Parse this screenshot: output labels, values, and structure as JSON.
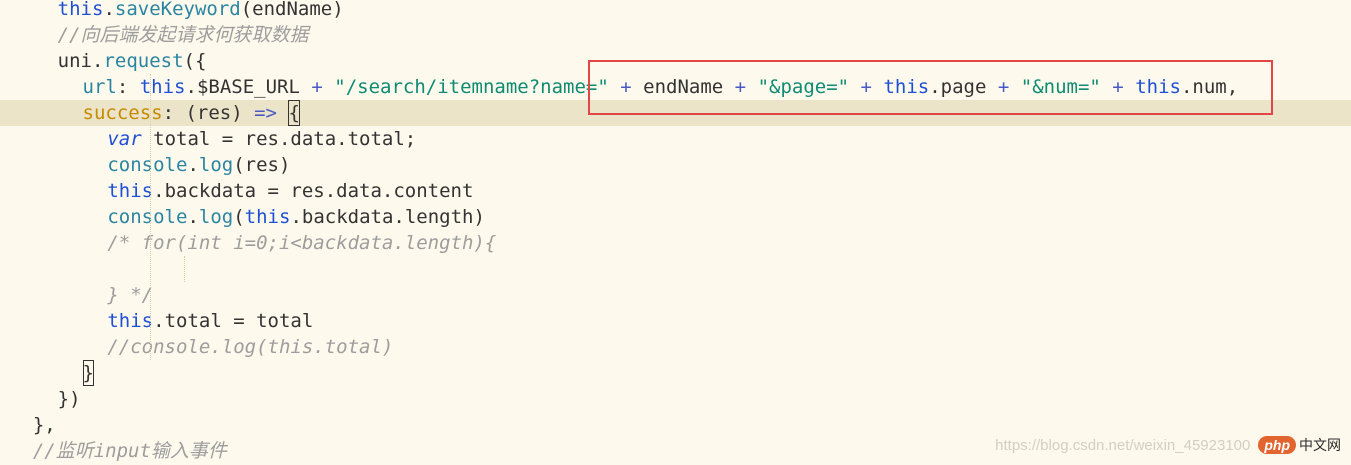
{
  "code_lines": [
    {
      "indent": 4,
      "tokens": [
        {
          "t": "this",
          "c": "kw"
        },
        {
          "t": ".",
          "c": "txt"
        },
        {
          "t": "saveKeyword",
          "c": "fn"
        },
        {
          "t": "(endName)",
          "c": "txt"
        }
      ]
    },
    {
      "indent": 4,
      "tokens": [
        {
          "t": "//向后端发起请求何获取数据",
          "c": "cmt"
        }
      ]
    },
    {
      "indent": 4,
      "tokens": [
        {
          "t": "uni",
          "c": "txt"
        },
        {
          "t": ".",
          "c": "txt"
        },
        {
          "t": "request",
          "c": "fn"
        },
        {
          "t": "({",
          "c": "txt"
        }
      ]
    },
    {
      "indent": 6,
      "tokens": [
        {
          "t": "url",
          "c": "fn"
        },
        {
          "t": ": ",
          "c": "txt"
        },
        {
          "t": "this",
          "c": "kw"
        },
        {
          "t": ".$BASE_URL ",
          "c": "txt"
        },
        {
          "t": "+",
          "c": "op"
        },
        {
          "t": " ",
          "c": "txt"
        },
        {
          "t": "\"/search/itemname?name=\"",
          "c": "str"
        },
        {
          "t": " ",
          "c": "txt"
        },
        {
          "t": "+",
          "c": "op"
        },
        {
          "t": " endName ",
          "c": "txt"
        },
        {
          "t": "+",
          "c": "op"
        },
        {
          "t": " ",
          "c": "txt"
        },
        {
          "t": "\"&page=\"",
          "c": "str"
        },
        {
          "t": " ",
          "c": "txt"
        },
        {
          "t": "+",
          "c": "op"
        },
        {
          "t": " ",
          "c": "txt"
        },
        {
          "t": "this",
          "c": "kw"
        },
        {
          "t": ".page ",
          "c": "txt"
        },
        {
          "t": "+",
          "c": "op"
        },
        {
          "t": " ",
          "c": "txt"
        },
        {
          "t": "\"&num=\"",
          "c": "str"
        },
        {
          "t": " ",
          "c": "txt"
        },
        {
          "t": "+",
          "c": "op"
        },
        {
          "t": " ",
          "c": "txt"
        },
        {
          "t": "this",
          "c": "kw"
        },
        {
          "t": ".num,",
          "c": "txt"
        }
      ]
    },
    {
      "indent": 6,
      "current": true,
      "tokens": [
        {
          "t": "success",
          "c": "key"
        },
        {
          "t": ": (res) ",
          "c": "txt"
        },
        {
          "t": "=>",
          "c": "op"
        },
        {
          "t": " ",
          "c": "txt"
        },
        {
          "t": "{",
          "c": "txt",
          "cursor": true
        }
      ]
    },
    {
      "indent": 8,
      "tokens": [
        {
          "t": "var",
          "c": "var"
        },
        {
          "t": " total = res.data.total;",
          "c": "txt"
        }
      ]
    },
    {
      "indent": 8,
      "tokens": [
        {
          "t": "console",
          "c": "fn"
        },
        {
          "t": ".",
          "c": "txt"
        },
        {
          "t": "log",
          "c": "fn"
        },
        {
          "t": "(res)",
          "c": "txt"
        }
      ]
    },
    {
      "indent": 8,
      "tokens": [
        {
          "t": "this",
          "c": "kw"
        },
        {
          "t": ".backdata = res.data.content",
          "c": "txt"
        }
      ]
    },
    {
      "indent": 8,
      "tokens": [
        {
          "t": "console",
          "c": "fn"
        },
        {
          "t": ".",
          "c": "txt"
        },
        {
          "t": "log",
          "c": "fn"
        },
        {
          "t": "(",
          "c": "txt"
        },
        {
          "t": "this",
          "c": "kw"
        },
        {
          "t": ".backdata.length)",
          "c": "txt"
        }
      ]
    },
    {
      "indent": 8,
      "tokens": [
        {
          "t": "/* for(int i=0;i<backdata.length){",
          "c": "cmt"
        }
      ]
    },
    {
      "indent": 8,
      "tokens": []
    },
    {
      "indent": 8,
      "tokens": [
        {
          "t": "} */",
          "c": "cmt"
        }
      ]
    },
    {
      "indent": 8,
      "tokens": [
        {
          "t": "this",
          "c": "kw"
        },
        {
          "t": ".total = total",
          "c": "txt"
        }
      ]
    },
    {
      "indent": 8,
      "tokens": [
        {
          "t": "//console.log(this.total)",
          "c": "cmt"
        }
      ]
    },
    {
      "indent": 6,
      "tokens": [
        {
          "t": "}",
          "c": "txt",
          "cursor": true
        }
      ]
    },
    {
      "indent": 4,
      "tokens": [
        {
          "t": "})",
          "c": "txt"
        }
      ]
    },
    {
      "indent": 2,
      "tokens": [
        {
          "t": "},",
          "c": "txt"
        }
      ]
    },
    {
      "indent": 2,
      "tokens": [
        {
          "t": "//监听input输入事件",
          "c": "cmt"
        }
      ]
    }
  ],
  "watermark": {
    "url": "https://blog.csdn.net/weixin_45923100",
    "logo_badge": "php",
    "logo_text": "中文网"
  },
  "colors": {
    "background": "#fdf9ec",
    "current_line": "#ece4c9",
    "annotation_box": "#e24646",
    "keyword": "#1e4fd4",
    "string": "#0f8a73",
    "comment": "#9d9d9d"
  }
}
